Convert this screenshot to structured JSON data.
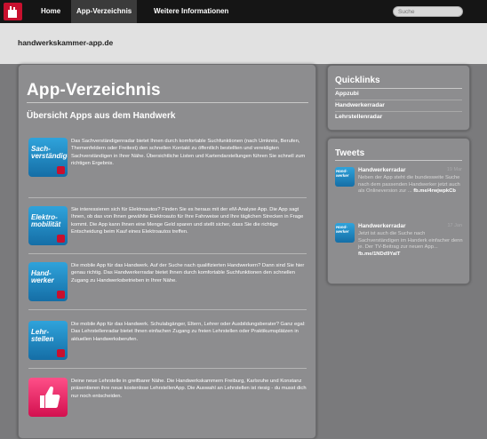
{
  "nav": {
    "items": [
      {
        "label": "Home"
      },
      {
        "label": "App-Verzeichnis"
      },
      {
        "label": "Weitere Informationen"
      }
    ],
    "search_placeholder": "Suche"
  },
  "header": {
    "domain": "handwerkskammer-app.de"
  },
  "main": {
    "title": "App-Verzeichnis",
    "subtitle": "Übersicht Apps aus dem Handwerk",
    "apps": [
      {
        "icon_text": [
          "Sach-",
          "verständige"
        ],
        "icon": "sachverstaendige-icon",
        "description": "Das Sachverständigenradar bietet Ihnen durch komfortable Suchfunktionen (nach Umkreis, Berufen, Themenfeldern oder Freitext) den schnellen Kontakt zu öffentlich bestellten und vereidigten Sachverständigen in Ihrer Nähe. Übersichtliche Listen und Kartendarstellungen führen Sie schnell zum richtigen Ergebnis."
      },
      {
        "icon_text": [
          "Elektro-",
          "mobilität"
        ],
        "icon": "elektromobilitaet-icon",
        "description": "Sie interessieren sich für Elektroautos? Finden Sie es heraus mit der eM-Analyse App. Die App sagt Ihnen, ob das von Ihnen gewählte Elektroauto für Ihre Fahrweise und Ihre täglichen Strecken in Frage kommt. Die App kann Ihnen eine Menge Geld sparen und stellt sicher, dass Sie die richtige Entscheidung beim Kauf eines Elektroautos treffen."
      },
      {
        "icon_text": [
          "Hand-",
          "werker"
        ],
        "icon": "handwerker-icon",
        "description": "Die mobile App für das Handwerk. Auf der Suche nach qualifizierten Handwerkern? Dann sind Sie hier genau richtig. Das Handwerkerradar bietet Ihnen durch komfortable Suchfunktionen den schnellen Zugang zu Handwerksbetrieben in Ihrer Nähe."
      },
      {
        "icon_text": [
          "Lehr-",
          "stellen"
        ],
        "icon": "lehrstellen-icon",
        "description": "Die mobile App für das Handwerk. Schulabgänger, Eltern, Lehrer oder Ausbildungsberater? Ganz egal: Das Lehrstellenradar bietet Ihnen einfachen Zugang zu freien Lehrstellen oder Praktikumsplätzen in aktuellen Handwerksberufen."
      },
      {
        "icon_text": [],
        "icon": "thumbs-up-icon",
        "description": "Deine neue Lehrstelle in greifbarer Nähe. Die Handwerkskammern Freiburg, Karlsruhe und Konstanz präsentieren ihre neue kostenlose LehrstellenApp. Die Auswahl an Lehrstellen ist riesig - du musst dich nur noch entscheiden."
      }
    ]
  },
  "quicklinks": {
    "title": "Quicklinks",
    "links": [
      "Appzubi",
      "Handwerkerradar",
      "Lehrstellenradar"
    ]
  },
  "tweets": {
    "title": "Tweets",
    "items": [
      {
        "avatar_text": [
          "Hand-",
          "werker"
        ],
        "name": "Handwerkerradar",
        "time": "19 Mar",
        "text": "Neben der App steht die bundesweite Suche nach dem passenden Handwerker jetzt auch als Onlineversion zur ...",
        "link": "fb.me/4rwjwpkCb"
      },
      {
        "avatar_text": [
          "Hand-",
          "werker"
        ],
        "name": "Handwerkerradar",
        "time": "17 Jan",
        "text": "Jetzt ist auch die Suche nach Sachverständigen im Handerk einfacher denn je. Der TV-Beitrag zur neuen App...",
        "link": "fb.me/1NDd9YaIT"
      }
    ]
  }
}
